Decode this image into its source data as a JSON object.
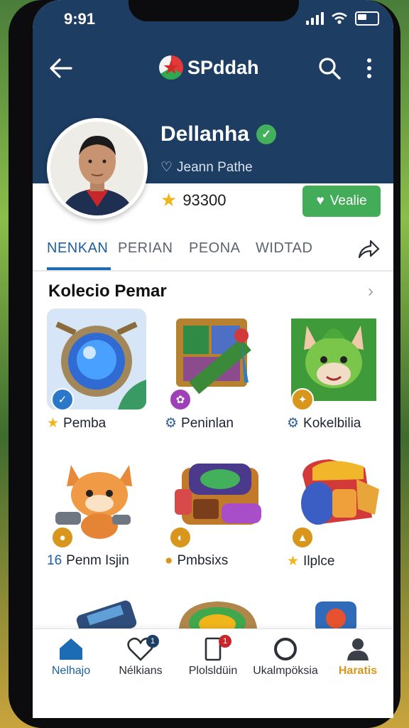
{
  "status": {
    "time": "9:91"
  },
  "app": {
    "name": "SPddah"
  },
  "profile": {
    "name": "Dellanha",
    "subtitle": "Jeann Pathe",
    "points": "93300",
    "follow_label": "Vealie"
  },
  "tabs": [
    {
      "label": "NENKAN",
      "active": true
    },
    {
      "label": "PERIAN",
      "active": false
    },
    {
      "label": "PEONA",
      "active": false
    },
    {
      "label": "WIDTAD",
      "active": false
    }
  ],
  "collection": {
    "title": "Kolecio Pemar",
    "items": [
      {
        "label": "Pemba",
        "icon": "star-icon"
      },
      {
        "label": "Peninlan",
        "icon": "gear-icon"
      },
      {
        "label": "Kokelbilia",
        "icon": "gear-icon"
      },
      {
        "label": "Penm Isjin",
        "prefix": "16",
        "icon": "none"
      },
      {
        "label": "Pmbsixs",
        "icon": "coin-icon"
      },
      {
        "label": "Ilplce",
        "icon": "star-icon"
      }
    ]
  },
  "bottom_nav": [
    {
      "label": "Nelhajo",
      "icon": "home-icon",
      "active": true
    },
    {
      "label": "Nélkians",
      "icon": "heart-icon",
      "badge": "1"
    },
    {
      "label": "Plolsldüin",
      "icon": "device-icon",
      "badge": "1"
    },
    {
      "label": "Ukalmpöksia",
      "icon": "circle-icon"
    },
    {
      "label": "Haratis",
      "icon": "person-icon"
    }
  ],
  "colors": {
    "header_bg": "#1d3d63",
    "accent_blue": "#1b6cb5",
    "accent_green": "#43ac59",
    "highlight_orange": "#d8961c"
  }
}
